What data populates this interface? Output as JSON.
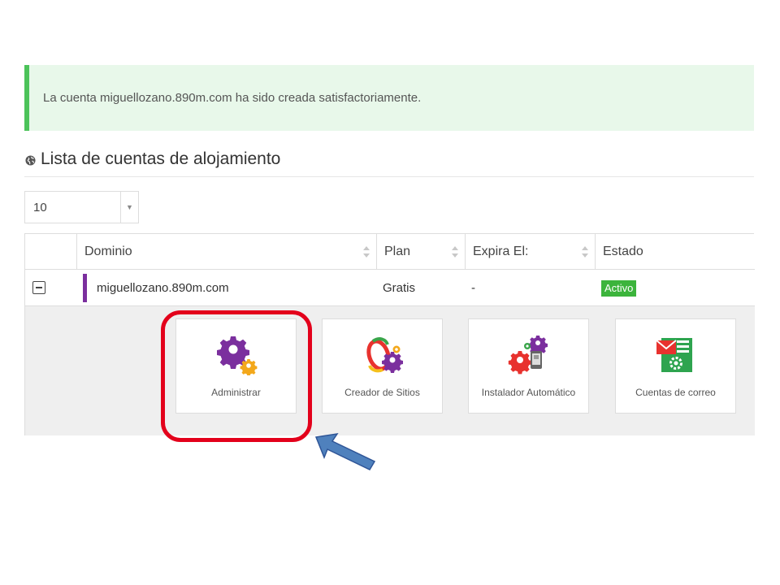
{
  "alert": {
    "message": "La cuenta miguellozano.890m.com ha sido creada satisfactoriamente."
  },
  "section": {
    "title": "Lista de cuentas de alojamiento",
    "icon": "globe-icon"
  },
  "page_size": {
    "value": "10"
  },
  "table": {
    "headers": {
      "domain": "Dominio",
      "plan": "Plan",
      "expires": "Expira El:",
      "status": "Estado"
    },
    "row": {
      "domain": "miguellozano.890m.com",
      "plan": "Gratis",
      "expires": "-",
      "status": "Activo"
    }
  },
  "tiles": [
    {
      "label": "Administrar",
      "icon": "gears-icon"
    },
    {
      "label": "Creador de Sitios",
      "icon": "site-builder-icon"
    },
    {
      "label": "Instalador Automático",
      "icon": "auto-installer-icon"
    },
    {
      "label": "Cuentas de correo",
      "icon": "email-accounts-icon"
    }
  ],
  "colors": {
    "alert_bg": "#e8f8ea",
    "alert_border": "#4cc35a",
    "accent_purple": "#7b2f9e",
    "status_green": "#3cb43c",
    "highlight_red": "#e3001b",
    "arrow_blue": "#4f81bd"
  }
}
